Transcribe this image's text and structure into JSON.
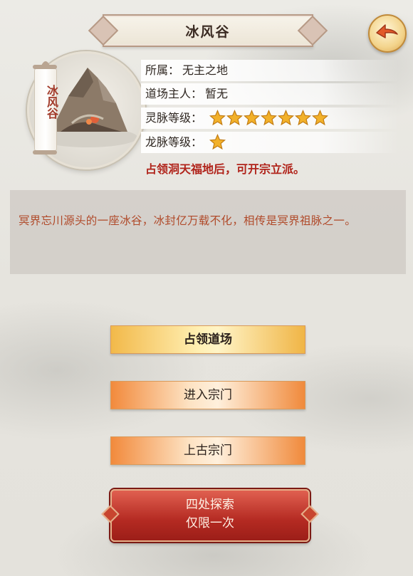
{
  "header": {
    "title": "冰风谷"
  },
  "portrait": {
    "scroll_text": "冰风谷"
  },
  "info": {
    "owner_label": "所属：",
    "owner_value": "无主之地",
    "master_label": "道场主人：",
    "master_value": "暂无",
    "spirit_label": "灵脉等级：",
    "spirit_stars": 7,
    "dragon_label": "龙脉等级：",
    "dragon_stars": 1,
    "notice": "占领洞天福地后，可开宗立派。"
  },
  "description": {
    "text": "冥界忘川源头的一座冰谷，冰封亿万载不化，相传是冥界祖脉之一。"
  },
  "buttons": {
    "occupy": "占领道场",
    "enter_sect": "进入宗门",
    "ancient_sect": "上古宗门",
    "explore_line1": "四处探索",
    "explore_line2": "仅限一次"
  },
  "colors": {
    "notice": "#b0231a",
    "description": "#b04a2a",
    "star": "#f2b12a",
    "explore_button": "#b42a22"
  },
  "icons": {
    "back": "back-arrow-icon",
    "star": "star-icon"
  }
}
